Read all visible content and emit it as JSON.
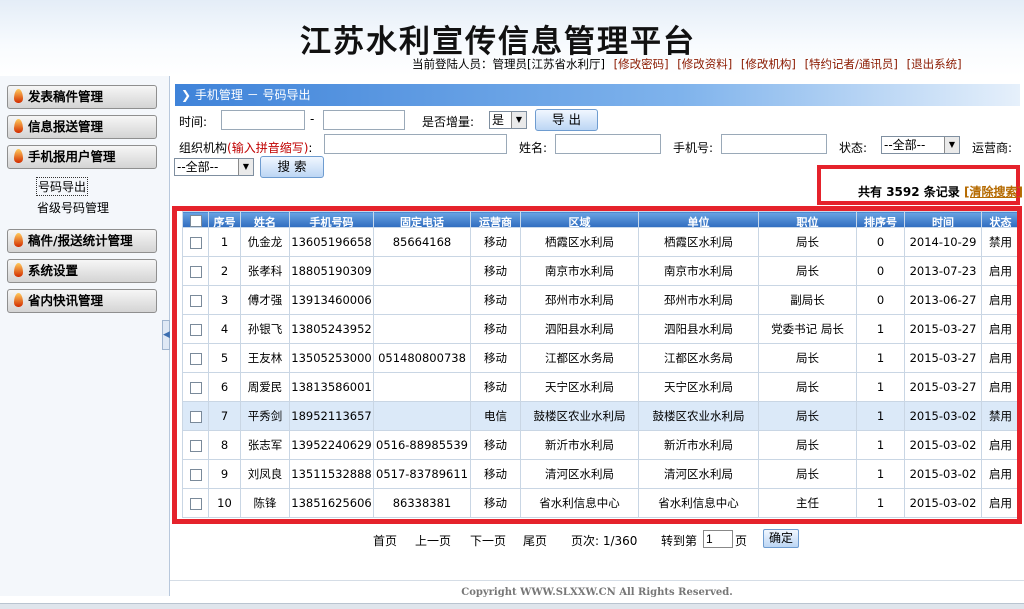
{
  "app": {
    "title": "江苏水利宣传信息管理平台",
    "current_user": "当前登陆人员：管理员[江苏省水利厅]",
    "links": [
      "[修改密码]",
      "[修改资料]",
      "[修改机构]",
      "[特约记者/通讯员]",
      "[退出系统]"
    ]
  },
  "sidebar": {
    "items": [
      "发表稿件管理",
      "信息报送管理",
      "手机报用户管理",
      "稿件/报送统计管理",
      "系统设置",
      "省内快讯管理"
    ],
    "subitems": [
      "号码导出",
      "省级号码管理"
    ]
  },
  "breadcrumb": "手机管理 － 号码导出",
  "filters": {
    "time_label": "时间:",
    "dash": "-",
    "incremental_label": "是否增量:",
    "incremental_value": "是",
    "export_label": "导 出",
    "org_label": "组织机构",
    "org_hint": "(输入拼音缩写)",
    "org_colon": ":",
    "name_label": "姓名:",
    "phone_label": "手机号:",
    "status_label": "状态:",
    "status_value": "--全部--",
    "carrier_label": "运营商:",
    "carrier_value": "--全部--",
    "search_label": "搜 索"
  },
  "summary": {
    "prefix": "共有",
    "count": "3592",
    "suffix": "条记录",
    "clear": "[清除搜索]"
  },
  "table": {
    "headers": [
      "序号",
      "姓名",
      "手机号码",
      "固定电话",
      "运营商",
      "区域",
      "单位",
      "职位",
      "排序号",
      "时间",
      "状态"
    ],
    "rows": [
      [
        "1",
        "仇金龙",
        "13605196658",
        "85664168",
        "移动",
        "栖霞区水利局",
        "栖霞区水利局",
        "局长",
        "0",
        "2014-10-29",
        "禁用"
      ],
      [
        "2",
        "张孝科",
        "18805190309",
        "",
        "移动",
        "南京市水利局",
        "南京市水利局",
        "局长",
        "0",
        "2013-07-23",
        "启用"
      ],
      [
        "3",
        "傅才强",
        "13913460006",
        "",
        "移动",
        "邳州市水利局",
        "邳州市水利局",
        "副局长",
        "0",
        "2013-06-27",
        "启用"
      ],
      [
        "4",
        "孙银飞",
        "13805243952",
        "",
        "移动",
        "泗阳县水利局",
        "泗阳县水利局",
        "党委书记 局长",
        "1",
        "2015-03-27",
        "启用"
      ],
      [
        "5",
        "王友林",
        "13505253000",
        "051480800738",
        "移动",
        "江都区水务局",
        "江都区水务局",
        "局长",
        "1",
        "2015-03-27",
        "启用"
      ],
      [
        "6",
        "周爱民",
        "13813586001",
        "",
        "移动",
        "天宁区水利局",
        "天宁区水利局",
        "局长",
        "1",
        "2015-03-27",
        "启用"
      ],
      [
        "7",
        "平秀剑",
        "18952113657",
        "",
        "电信",
        "鼓楼区农业水利局",
        "鼓楼区农业水利局",
        "局长",
        "1",
        "2015-03-02",
        "禁用"
      ],
      [
        "8",
        "张志军",
        "13952240629",
        "0516-88985539",
        "移动",
        "新沂市水利局",
        "新沂市水利局",
        "局长",
        "1",
        "2015-03-02",
        "启用"
      ],
      [
        "9",
        "刘凤良",
        "13511532888",
        "0517-83789611",
        "移动",
        "清河区水利局",
        "清河区水利局",
        "局长",
        "1",
        "2015-03-02",
        "启用"
      ],
      [
        "10",
        "陈锋",
        "13851625606",
        "86338381",
        "移动",
        "省水利信息中心",
        "省水利信息中心",
        "主任",
        "1",
        "2015-03-02",
        "启用"
      ]
    ]
  },
  "pager": {
    "first": "首页",
    "prev": "上一页",
    "next": "下一页",
    "last": "尾页",
    "page_info": "页次: 1/360",
    "goto_label": "转到第",
    "goto_value": "1",
    "page_unit": "页",
    "confirm": "确定"
  },
  "footer": "Copyright WWW.SLXXW.CN All Rights Reserved."
}
